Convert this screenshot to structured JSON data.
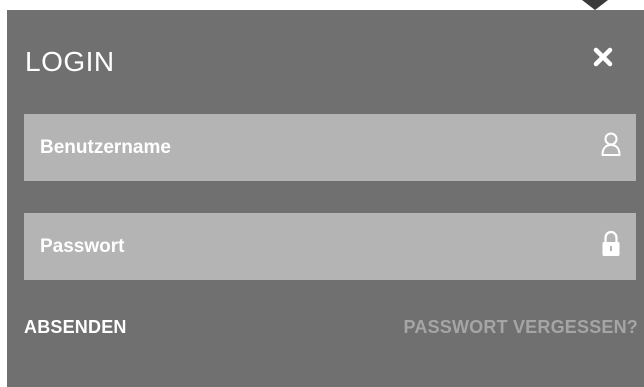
{
  "login": {
    "title": "LOGIN",
    "close_icon": "close-icon",
    "username": {
      "placeholder": "Benutzername",
      "icon": "user-icon"
    },
    "password": {
      "placeholder": "Passwort",
      "icon": "lock-icon"
    },
    "submit_label": "ABSENDEN",
    "forgot_label": "PASSWORT VERGESSEN?"
  },
  "colors": {
    "panel_bg": "#707070",
    "field_bg": "#b4b4b4",
    "text": "#ffffff",
    "muted_link": "#a5a5a5",
    "caret": "#3a3a3a"
  }
}
